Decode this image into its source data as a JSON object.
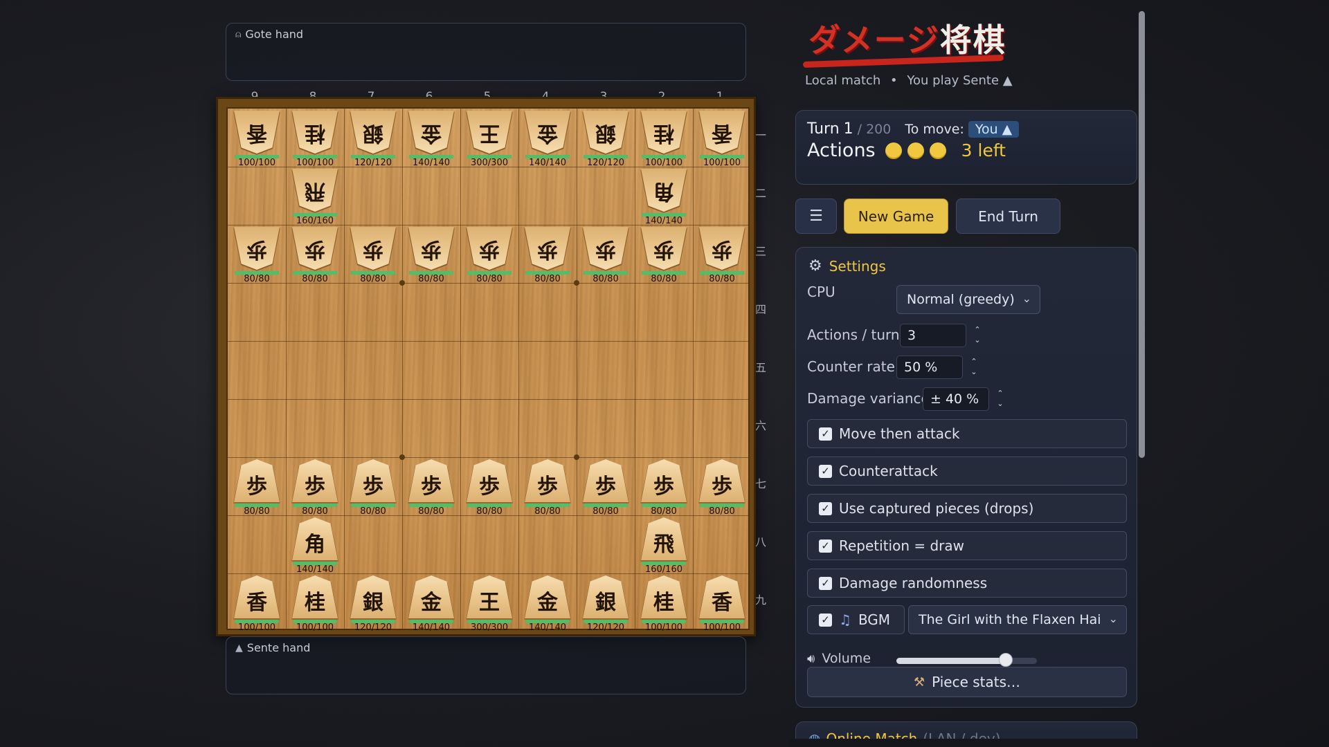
{
  "hands": {
    "gote_label": "Gote hand",
    "sente_label": "Sente hand"
  },
  "files": [
    "9",
    "8",
    "7",
    "6",
    "5",
    "4",
    "3",
    "2",
    "1"
  ],
  "ranks": [
    "一",
    "二",
    "三",
    "四",
    "五",
    "六",
    "七",
    "八",
    "九"
  ],
  "board": {
    "pieces": [
      {
        "file": 9,
        "rank": 1,
        "kanji": "香",
        "owner": "gote",
        "hp": "100/100"
      },
      {
        "file": 8,
        "rank": 1,
        "kanji": "桂",
        "owner": "gote",
        "hp": "100/100"
      },
      {
        "file": 7,
        "rank": 1,
        "kanji": "銀",
        "owner": "gote",
        "hp": "120/120"
      },
      {
        "file": 6,
        "rank": 1,
        "kanji": "金",
        "owner": "gote",
        "hp": "140/140"
      },
      {
        "file": 5,
        "rank": 1,
        "kanji": "王",
        "owner": "gote",
        "hp": "300/300"
      },
      {
        "file": 4,
        "rank": 1,
        "kanji": "金",
        "owner": "gote",
        "hp": "140/140"
      },
      {
        "file": 3,
        "rank": 1,
        "kanji": "銀",
        "owner": "gote",
        "hp": "120/120"
      },
      {
        "file": 2,
        "rank": 1,
        "kanji": "桂",
        "owner": "gote",
        "hp": "100/100"
      },
      {
        "file": 1,
        "rank": 1,
        "kanji": "香",
        "owner": "gote",
        "hp": "100/100"
      },
      {
        "file": 8,
        "rank": 2,
        "kanji": "飛",
        "owner": "gote",
        "hp": "160/160"
      },
      {
        "file": 2,
        "rank": 2,
        "kanji": "角",
        "owner": "gote",
        "hp": "140/140"
      },
      {
        "file": 9,
        "rank": 3,
        "kanji": "歩",
        "owner": "gote",
        "hp": "80/80"
      },
      {
        "file": 8,
        "rank": 3,
        "kanji": "歩",
        "owner": "gote",
        "hp": "80/80"
      },
      {
        "file": 7,
        "rank": 3,
        "kanji": "歩",
        "owner": "gote",
        "hp": "80/80"
      },
      {
        "file": 6,
        "rank": 3,
        "kanji": "歩",
        "owner": "gote",
        "hp": "80/80"
      },
      {
        "file": 5,
        "rank": 3,
        "kanji": "歩",
        "owner": "gote",
        "hp": "80/80"
      },
      {
        "file": 4,
        "rank": 3,
        "kanji": "歩",
        "owner": "gote",
        "hp": "80/80"
      },
      {
        "file": 3,
        "rank": 3,
        "kanji": "歩",
        "owner": "gote",
        "hp": "80/80"
      },
      {
        "file": 2,
        "rank": 3,
        "kanji": "歩",
        "owner": "gote",
        "hp": "80/80"
      },
      {
        "file": 1,
        "rank": 3,
        "kanji": "歩",
        "owner": "gote",
        "hp": "80/80"
      },
      {
        "file": 9,
        "rank": 7,
        "kanji": "歩",
        "owner": "sente",
        "hp": "80/80"
      },
      {
        "file": 8,
        "rank": 7,
        "kanji": "歩",
        "owner": "sente",
        "hp": "80/80"
      },
      {
        "file": 7,
        "rank": 7,
        "kanji": "歩",
        "owner": "sente",
        "hp": "80/80"
      },
      {
        "file": 6,
        "rank": 7,
        "kanji": "歩",
        "owner": "sente",
        "hp": "80/80"
      },
      {
        "file": 5,
        "rank": 7,
        "kanji": "歩",
        "owner": "sente",
        "hp": "80/80"
      },
      {
        "file": 4,
        "rank": 7,
        "kanji": "歩",
        "owner": "sente",
        "hp": "80/80"
      },
      {
        "file": 3,
        "rank": 7,
        "kanji": "歩",
        "owner": "sente",
        "hp": "80/80"
      },
      {
        "file": 2,
        "rank": 7,
        "kanji": "歩",
        "owner": "sente",
        "hp": "80/80"
      },
      {
        "file": 1,
        "rank": 7,
        "kanji": "歩",
        "owner": "sente",
        "hp": "80/80"
      },
      {
        "file": 8,
        "rank": 8,
        "kanji": "角",
        "owner": "sente",
        "hp": "140/140"
      },
      {
        "file": 2,
        "rank": 8,
        "kanji": "飛",
        "owner": "sente",
        "hp": "160/160"
      },
      {
        "file": 9,
        "rank": 9,
        "kanji": "香",
        "owner": "sente",
        "hp": "100/100"
      },
      {
        "file": 8,
        "rank": 9,
        "kanji": "桂",
        "owner": "sente",
        "hp": "100/100"
      },
      {
        "file": 7,
        "rank": 9,
        "kanji": "銀",
        "owner": "sente",
        "hp": "120/120"
      },
      {
        "file": 6,
        "rank": 9,
        "kanji": "金",
        "owner": "sente",
        "hp": "140/140"
      },
      {
        "file": 5,
        "rank": 9,
        "kanji": "王",
        "owner": "sente",
        "hp": "300/300"
      },
      {
        "file": 4,
        "rank": 9,
        "kanji": "金",
        "owner": "sente",
        "hp": "140/140"
      },
      {
        "file": 3,
        "rank": 9,
        "kanji": "銀",
        "owner": "sente",
        "hp": "120/120"
      },
      {
        "file": 2,
        "rank": 9,
        "kanji": "桂",
        "owner": "sente",
        "hp": "100/100"
      },
      {
        "file": 1,
        "rank": 9,
        "kanji": "香",
        "owner": "sente",
        "hp": "100/100"
      }
    ]
  },
  "header": {
    "logo_text_a": "ダメージ",
    "logo_text_b": "将棋",
    "subtitle_mode": "Local match",
    "subtitle_sep": "•",
    "subtitle_side": "You play Sente ▲"
  },
  "turn": {
    "label": "Turn",
    "number": "1",
    "max": "/ 200",
    "to_move_label": "To move:",
    "to_move_value": "You ▲",
    "actions_label": "Actions",
    "actions_remaining": 3,
    "actions_left_text": "3 left"
  },
  "buttons": {
    "menu": "☰",
    "new_game": "New Game",
    "end_turn": "End Turn"
  },
  "settings": {
    "title": "Settings",
    "cpu_label": "CPU",
    "cpu_value": "Normal (greedy)",
    "actions_per_turn_label": "Actions / turn",
    "actions_per_turn_value": "3",
    "counter_rate_label": "Counter rate",
    "counter_rate_value": "50 %",
    "damage_variance_label": "Damage variance",
    "damage_variance_value": "± 40 %",
    "checkboxes": [
      {
        "label": "Move then attack",
        "checked": true
      },
      {
        "label": "Counterattack",
        "checked": true
      },
      {
        "label": "Use captured pieces (drops)",
        "checked": true
      },
      {
        "label": "Repetition = draw",
        "checked": true
      },
      {
        "label": "Damage randomness",
        "checked": true
      }
    ],
    "bgm_label": "BGM",
    "bgm_checked": true,
    "bgm_track": "The Girl with the Flaxen Hai",
    "volume_label": "Volume",
    "volume_level": 0.78,
    "piece_stats_label": "Piece stats…"
  },
  "online": {
    "title": "Online Match",
    "subtitle": "(LAN / dev)"
  },
  "colors": {
    "accent": "#f0c73e",
    "hp_bar": "#4fc06a",
    "board": "#d09a58"
  }
}
